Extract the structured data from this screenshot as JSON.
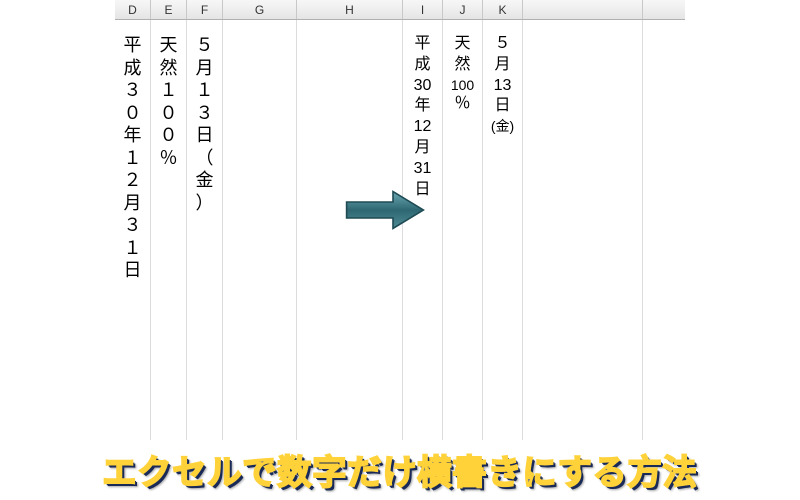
{
  "columns": {
    "D": "D",
    "E": "E",
    "F": "F",
    "G": "G",
    "H": "H",
    "I": "I",
    "J": "J",
    "K": "K"
  },
  "before": {
    "D": {
      "chars": [
        "平",
        "成",
        "３",
        "０",
        "年",
        "１",
        "２",
        "月",
        "３",
        "１",
        "日"
      ]
    },
    "E": {
      "chars": [
        "天",
        "然",
        "１",
        "０",
        "０",
        "％"
      ]
    },
    "F": {
      "chars": [
        "５",
        "月",
        "１",
        "３",
        "日",
        "（",
        "金",
        "）"
      ]
    }
  },
  "after": {
    "I": {
      "groups": [
        "平",
        "成",
        "30",
        "年",
        "12",
        "月",
        "31",
        "日"
      ]
    },
    "J": {
      "groups": [
        "天",
        "然",
        "100",
        "％"
      ]
    },
    "K": {
      "groups": [
        "５",
        "月",
        "13",
        "日",
        "(金)"
      ]
    }
  },
  "caption": "エクセルで数字だけ横書きにする方法",
  "colors": {
    "arrow_fill": "#3f7a86",
    "arrow_stroke": "#1e4a54",
    "caption_fill": "#274aa8",
    "caption_stroke": "#ffd23a"
  }
}
